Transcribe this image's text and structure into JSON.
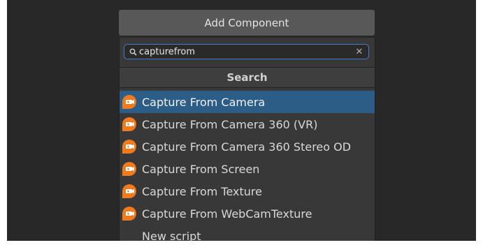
{
  "header": {
    "add_component_label": "Add Component"
  },
  "search": {
    "value": "capturefrom",
    "placeholder": ""
  },
  "section": {
    "title": "Search"
  },
  "results": [
    {
      "label": "Capture From Camera",
      "icon": "capture-camera-icon",
      "selected": true
    },
    {
      "label": "Capture From Camera 360 (VR)",
      "icon": "capture-camera-icon",
      "selected": false
    },
    {
      "label": "Capture From Camera 360 Stereo OD",
      "icon": "capture-camera-icon",
      "selected": false
    },
    {
      "label": "Capture From Screen",
      "icon": "capture-camera-icon",
      "selected": false
    },
    {
      "label": "Capture From Texture",
      "icon": "capture-camera-icon",
      "selected": false
    },
    {
      "label": "Capture From WebCamTexture",
      "icon": "capture-camera-icon",
      "selected": false
    },
    {
      "label": "New script",
      "icon": "",
      "selected": false
    }
  ],
  "colors": {
    "background": "#282828",
    "panel": "#383838",
    "selection": "#2c5d87",
    "focus_border": "#3d7ed4",
    "icon_orange": "#f07a1c"
  }
}
